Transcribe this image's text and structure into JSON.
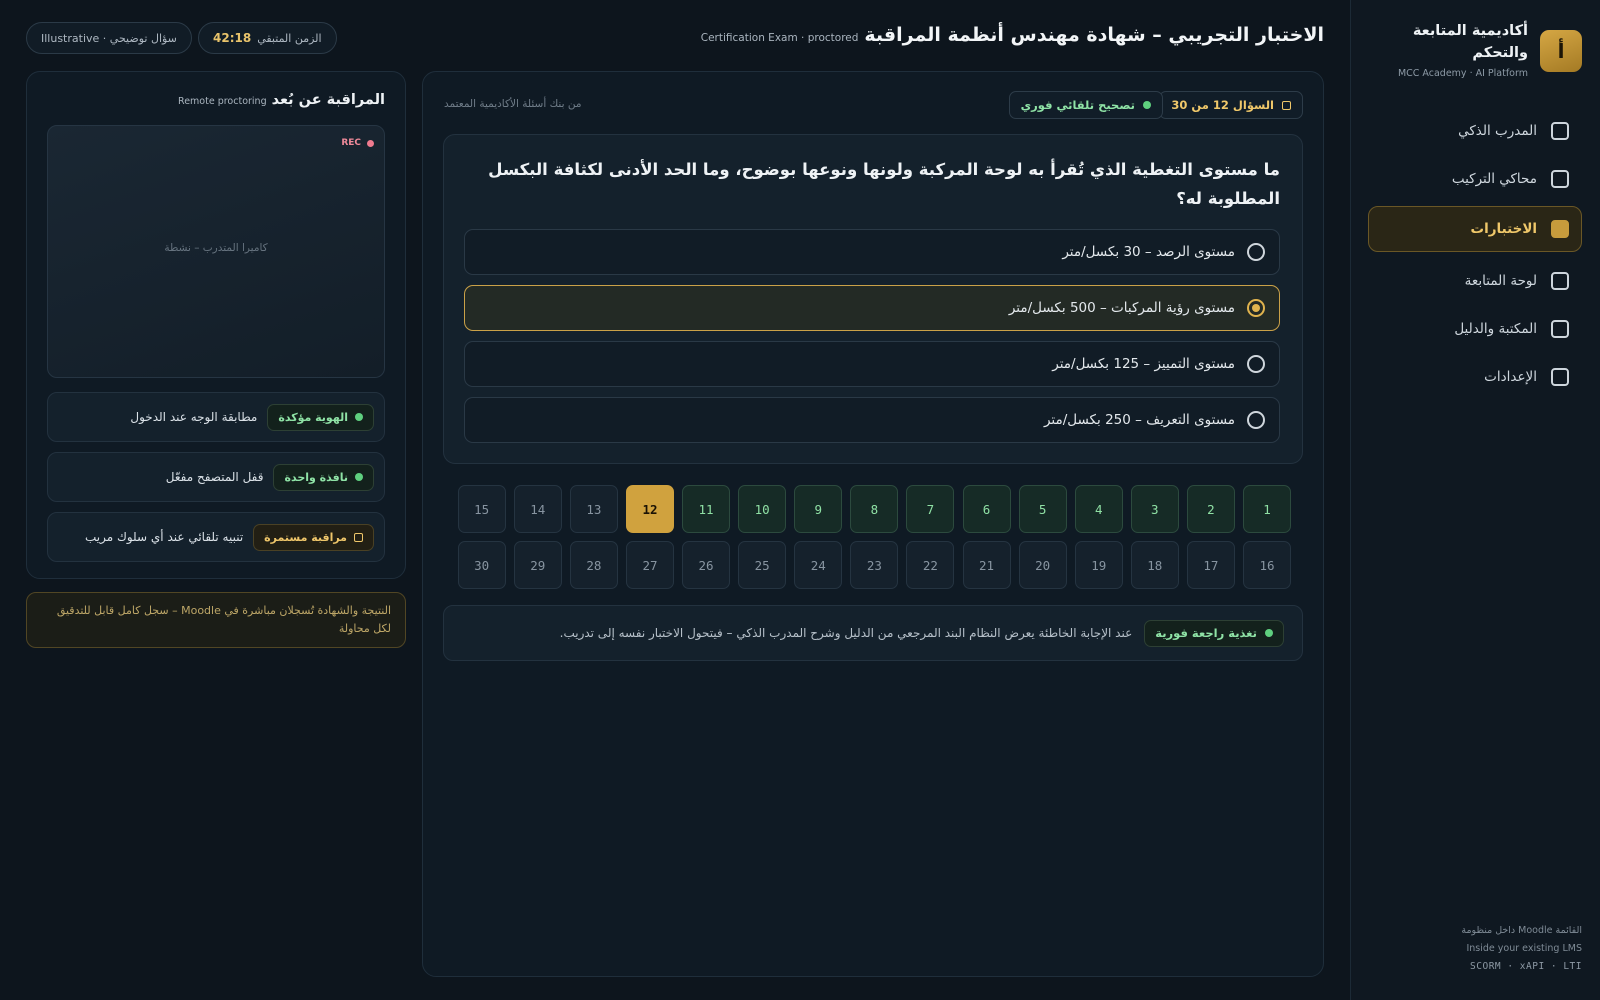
{
  "brand": {
    "logo_letter": "أ",
    "name": "أكاديمية المتابعة والتحكم",
    "subtitle": "MCC Academy · AI Platform"
  },
  "nav": {
    "items": [
      {
        "label": "المدرب الذكي",
        "active": false
      },
      {
        "label": "محاكي التركيب",
        "active": false
      },
      {
        "label": "الاختبارات",
        "active": true
      },
      {
        "label": "لوحة المتابعة",
        "active": false
      },
      {
        "label": "المكتبة والدليل",
        "active": false
      },
      {
        "label": "الإعدادات",
        "active": false
      }
    ]
  },
  "sidebar_footer": {
    "line1": "داخل منظومة Moodle القائمة",
    "line2": "Inside your existing LMS",
    "line3": "SCORM · xAPI · LTI"
  },
  "header": {
    "title": "الاختبار التجريبي – شهادة مهندس أنظمة المراقبة",
    "subtitle": "Certification Exam · proctored",
    "timer_label": "الزمن المتبقي",
    "timer_value": "42:18",
    "illustrative": "سؤال توضيحي · Illustrative"
  },
  "exam": {
    "question_counter": "السؤال 12 من 30",
    "grading_label": "تصحيح تلقائي فوري",
    "bank_source": "من بنك أسئلة الأكاديمية المعتمد",
    "question": "ما مستوى التغطية الذي تُقرأ به لوحة المركبة ولونها ونوعها بوضوح، وما الحد الأدنى لكثافة البكسل المطلوبة له؟",
    "options": [
      {
        "label": "مستوى الرصد – 30 بكسل/متر",
        "selected": false
      },
      {
        "label": "مستوى رؤية المركبات – 500 بكسل/متر",
        "selected": true
      },
      {
        "label": "مستوى التمييز – 125 بكسل/متر",
        "selected": false
      },
      {
        "label": "مستوى التعريف – 250 بكسل/متر",
        "selected": false
      }
    ],
    "navigator": {
      "total": 30,
      "current": 12,
      "answered": [
        1,
        2,
        3,
        4,
        5,
        6,
        7,
        8,
        9,
        10,
        11
      ],
      "cells": [
        "1",
        "2",
        "3",
        "4",
        "5",
        "6",
        "7",
        "8",
        "9",
        "10",
        "11",
        "12",
        "13",
        "14",
        "15",
        "16",
        "17",
        "18",
        "19",
        "20",
        "21",
        "22",
        "23",
        "24",
        "25",
        "26",
        "27",
        "28",
        "29",
        "30"
      ]
    },
    "feedback": {
      "chip": "تغذية راجعة فورية",
      "text": "عند الإجابة الخاطئة يعرض النظام البند المرجعي من الدليل وشرح المدرب الذكي – فيتحول الاختبار نفسه إلى تدريب."
    }
  },
  "proctoring": {
    "title": "المراقبة عن بُعد",
    "subtitle": "Remote proctoring",
    "rec_label": "REC",
    "camera_label": "كاميرا المتدرب – نشطة",
    "checks": [
      {
        "status": "الهوية مؤكدة",
        "status_type": "ok",
        "text": "مطابقة الوجه عند الدخول"
      },
      {
        "status": "نافذة واحدة",
        "status_type": "ok",
        "text": "قفل المتصفح مفعّل"
      },
      {
        "status": "مراقبة مستمرة",
        "status_type": "warn",
        "text": "تنبيه تلقائي عند أي سلوك مريب"
      }
    ],
    "moodle_note": "النتيجة والشهادة تُسجلان مباشرة في Moodle – سجل كامل قابل للتدقيق لكل محاولة"
  },
  "colors": {
    "accent_gold": "#d0a23e",
    "success_green": "#5fd07f",
    "background": "#0d151d",
    "rec_red": "#f07b8f"
  }
}
